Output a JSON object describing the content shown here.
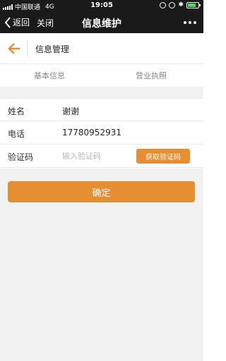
{
  "status_bar": {
    "carrier": "中国联通",
    "network": "4G",
    "time": "19:05",
    "battery_level": 0.8,
    "battery_color": "#4cd964"
  },
  "nav_bar": {
    "back_label": "返回",
    "close_label": "关闭",
    "title": "信息维护",
    "more_icon": "ellipsis-icon"
  },
  "page_header": {
    "title": "信息管理",
    "back_icon": "arrow-left-icon",
    "accent_color": "#e58e32"
  },
  "tabs": [
    {
      "label": "基本信息"
    },
    {
      "label": "营业执照"
    }
  ],
  "form": {
    "name": {
      "label": "姓名",
      "value": "谢谢"
    },
    "phone": {
      "label": "电话",
      "value": "17780952931"
    },
    "code": {
      "label": "验证码",
      "value": "",
      "placeholder": "输入验证码",
      "button_label": "获取验证码"
    }
  },
  "confirm_label": "确定"
}
